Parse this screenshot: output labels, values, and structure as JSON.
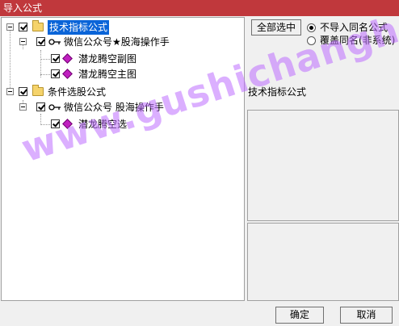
{
  "window": {
    "title": "导入公式"
  },
  "tree": {
    "nodes": [
      {
        "label": "技术指标公式"
      },
      {
        "label": "微信公众号★股海操作手"
      },
      {
        "label": "潜龙腾空副图"
      },
      {
        "label": "潜龙腾空主图"
      },
      {
        "label": "条件选股公式"
      },
      {
        "label": "微信公众号 股海操作手"
      },
      {
        "label": "潜龙腾空选"
      }
    ]
  },
  "options": {
    "select_all_label": "全部选中",
    "radio_no_import": "不导入同名公式",
    "radio_overwrite": "覆盖同名(非系统)"
  },
  "panel": {
    "title": "技术指标公式"
  },
  "watermark": "www.gushichanghong.com",
  "buttons": {
    "ok": "确定",
    "cancel": "取消"
  },
  "colors": {
    "titlebar": "#c0383c",
    "selection": "#0a64d8",
    "watermark": "#be6eff"
  }
}
